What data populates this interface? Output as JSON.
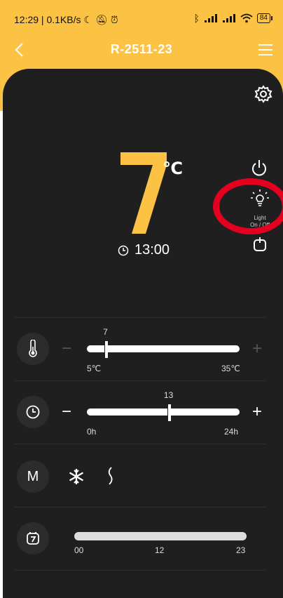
{
  "status_bar": {
    "time_speed": "12:29 | 0.1KB/s",
    "battery": "84",
    "icons": [
      "moon-icon",
      "bell-off-icon",
      "alarm-icon",
      "bluetooth-icon",
      "signal-icon",
      "signal-icon",
      "wifi-icon",
      "battery-icon"
    ]
  },
  "nav": {
    "title": "R-2511-23",
    "back_icon": "chevron-left-icon",
    "menu_icon": "menu-icon"
  },
  "display": {
    "temperature": "7",
    "unit": "℃",
    "time": "13:00"
  },
  "side_controls": {
    "light_label_line1": "Light",
    "light_label_line2": "On / Off"
  },
  "temp_slider": {
    "value_label": "7",
    "min_label": "5℃",
    "max_label": "35℃",
    "min": 5,
    "max": 35,
    "value": 7,
    "minus": "−",
    "plus": "+"
  },
  "time_slider": {
    "value_label": "13",
    "min_label": "0h",
    "max_label": "24h",
    "min": 0,
    "max": 24,
    "value": 13,
    "minus": "−",
    "plus": "+"
  },
  "mode_row": {
    "mode_label": "M",
    "options": [
      "snowflake-icon",
      "heat-wave-icon"
    ]
  },
  "schedule_row": {
    "labels": [
      "00",
      "12",
      "23"
    ]
  },
  "colors": {
    "accent": "#fcc244",
    "panel": "#1f1f1f",
    "annotation": "#e5001f"
  }
}
